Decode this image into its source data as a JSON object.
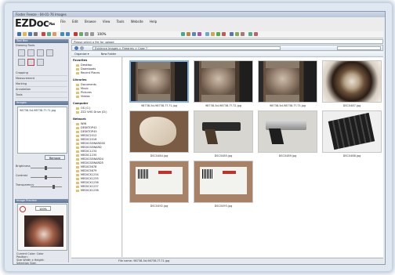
{
  "window": {
    "title": "Foster Freeze - 04-01-76 Images"
  },
  "app": {
    "logo": "EZDoc",
    "logo_suffix": "Plus"
  },
  "menu": [
    "File",
    "Edit",
    "Browse",
    "View",
    "Tools",
    "Website",
    "Help"
  ],
  "toolbar": {
    "zoom": "100%"
  },
  "left_panel": {
    "tools_header": "Tool Box",
    "drawing_tools_label": "Drawing Tools",
    "rows": [
      "Cropping",
      "Measurement",
      "Marking",
      "Annotation",
      "Tools"
    ],
    "images_header": "Images",
    "image_file": "98738-5d-98738-??-?1.jpg",
    "remove_button": "Remove",
    "brightness_label": "Brightness",
    "contrast_label": "Contrast",
    "transparency_label": "Transparency",
    "preview_header": "Image Preview",
    "preview_zoom": "100%",
    "info": {
      "lines": [
        "Current Color: Color",
        "Position:",
        "Size Width x Height:",
        "Selection Size:"
      ],
      "values": [
        "0",
        "?"
      ]
    }
  },
  "address": {
    "window_title": "Please select a file for upload",
    "path": "Evidence Images > Firearms > Case 7",
    "search_placeholder": ""
  },
  "organize": {
    "organize_label": "Organize ▾",
    "new_folder_label": "New Folder"
  },
  "nav": {
    "favorites": "Favorites",
    "fav_items": [
      "Desktop",
      "Downloads",
      "Recent Places"
    ],
    "libraries": "Libraries",
    "lib_items": [
      "Documents",
      "Music",
      "Pictures",
      "Videos"
    ],
    "computer": "Computer",
    "comp_items": [
      "OS (C:)",
      "ZZ2 VHS Drive (D:)"
    ],
    "network": "Network",
    "net_items": [
      "WIN",
      "DESKTOP42",
      "DESKTOP45",
      "MEDIC2012",
      "MEDIC2016",
      "MEDICSEWARD00",
      "MEDICSEWARD",
      "MEDIC1234",
      "MEDIC1235",
      "MEDICSEWARD4",
      "MEDICSEWARD5",
      "MEDIC5678",
      "MEDIC5679",
      "MEDICX1234",
      "MEDICX1235",
      "MEDICX1236",
      "MEDICX1237",
      "MEDICX1238"
    ]
  },
  "files": [
    {
      "name": "98738-5d-98738-??-?1.jpg",
      "kind": "tex",
      "selected": true
    },
    {
      "name": "98738-5d-98738-??-?2.jpg",
      "kind": "tex",
      "selected": false
    },
    {
      "name": "98738-5d-98738-??-?3.jpg",
      "kind": "tex",
      "selected": false
    },
    {
      "name": "DSC0487.jpg",
      "kind": "scope",
      "selected": false
    },
    {
      "name": "DSC0484.jpg",
      "kind": "cloth",
      "selected": false
    },
    {
      "name": "DSC0485.jpg",
      "kind": "gun",
      "selected": false
    },
    {
      "name": "DSC0489.jpg",
      "kind": "gun2",
      "selected": false
    },
    {
      "name": "DSC0488.jpg",
      "kind": "mag",
      "selected": false
    },
    {
      "name": "DSC0492.jpg",
      "kind": "label",
      "selected": false
    },
    {
      "name": "DSC0493.jpg",
      "kind": "label",
      "selected": false
    }
  ],
  "status": {
    "filename_label": "File name:",
    "filename_value": "98738-5d-98738-??-?1.jpg"
  }
}
